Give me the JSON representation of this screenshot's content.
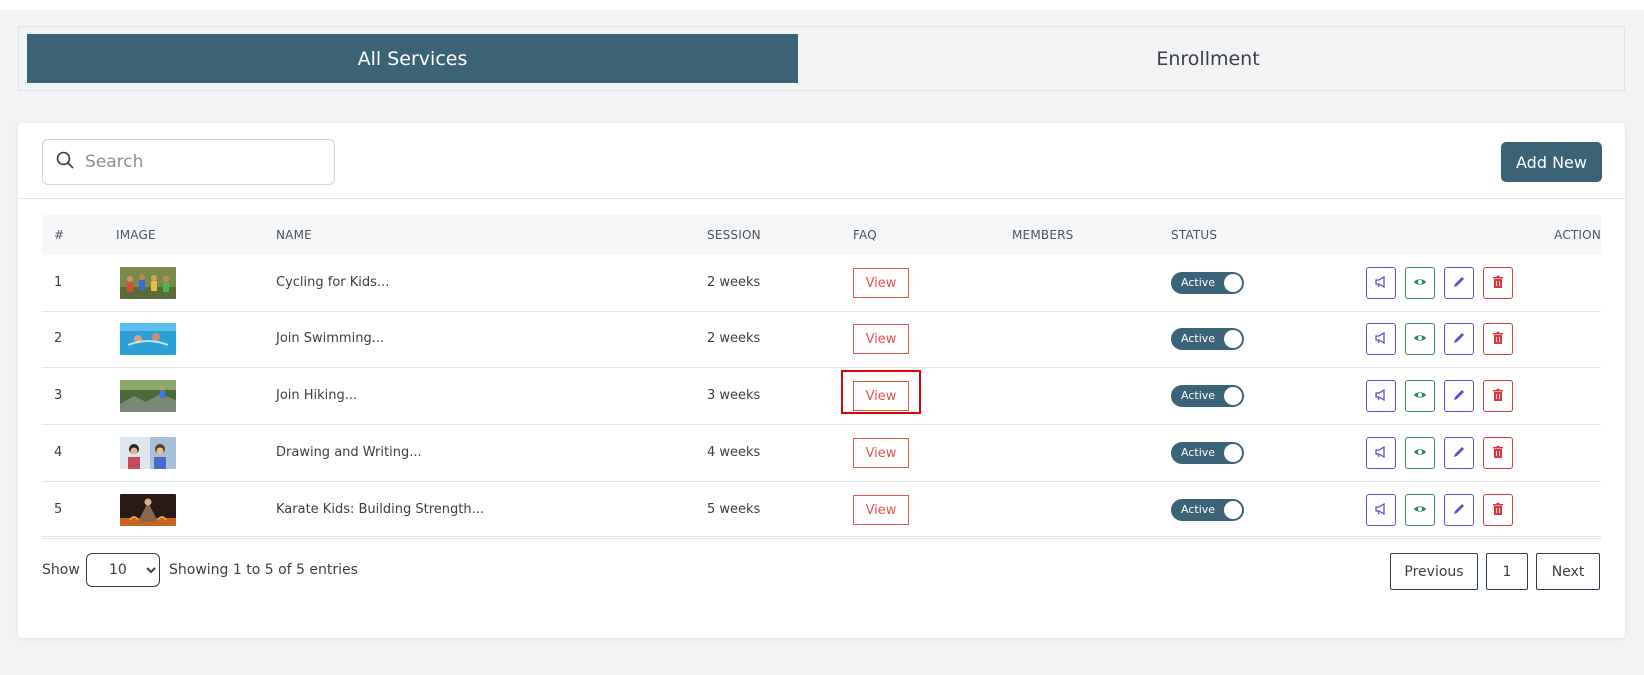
{
  "tabs": {
    "all_services": "All Services",
    "enrollment": "Enrollment"
  },
  "toolbar": {
    "search_placeholder": "Search",
    "search_icon": "search-icon",
    "add_new_label": "Add New"
  },
  "table": {
    "headers": {
      "index": "#",
      "image": "IMAGE",
      "name": "NAME",
      "session": "SESSION",
      "faq": "FAQ",
      "members": "MEMBERS",
      "status": "STATUS",
      "action": "ACTION"
    },
    "rows": [
      {
        "index": "1",
        "name": "Cycling for Kids...",
        "session": "2 weeks",
        "faq": "View",
        "members": "",
        "status": "Active"
      },
      {
        "index": "2",
        "name": "Join Swimming...",
        "session": "2 weeks",
        "faq": "View",
        "members": "",
        "status": "Active"
      },
      {
        "index": "3",
        "name": "Join Hiking...",
        "session": "3 weeks",
        "faq": "View",
        "members": "",
        "status": "Active"
      },
      {
        "index": "4",
        "name": "Drawing and Writing...",
        "session": "4 weeks",
        "faq": "View",
        "members": "",
        "status": "Active"
      },
      {
        "index": "5",
        "name": "Karate Kids: Building Strength...",
        "session": "5 weeks",
        "faq": "View",
        "members": "",
        "status": "Active"
      }
    ],
    "action_icons": [
      "megaphone-icon",
      "eye-icon",
      "pencil-icon",
      "trash-icon"
    ]
  },
  "footer": {
    "show_label": "Show",
    "page_size": "10",
    "page_size_options": [
      "10"
    ],
    "info": "Showing 1 to 5 of 5 entries",
    "previous_label": "Previous",
    "current_page": "1",
    "next_label": "Next"
  },
  "colors": {
    "primary": "#3b6378",
    "danger": "#d9363e",
    "success": "#2e8b57",
    "accent": "#5b4fd6",
    "faq_red": "#e5534b"
  }
}
